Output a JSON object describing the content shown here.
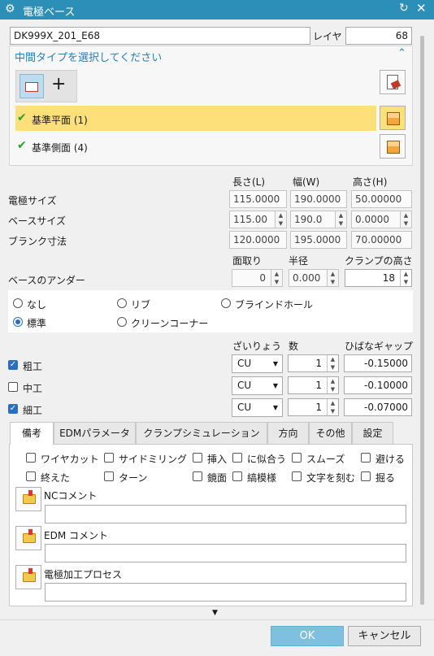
{
  "window": {
    "title": "電極ベース"
  },
  "name_field": {
    "value": "DK999X_201_E68"
  },
  "layer": {
    "label": "レイヤ",
    "value": "68"
  },
  "selection": {
    "prompt": "中間タイプを選択してください",
    "items": [
      {
        "label": "基準平面 (1)"
      },
      {
        "label": "基準側面 (4)"
      }
    ]
  },
  "dims": {
    "headers": {
      "length": "長さ(L)",
      "width": "幅(W)",
      "height": "高さ(H)"
    },
    "rows": [
      {
        "label": "電極サイズ",
        "v1": "115.0000",
        "v2": "190.0000",
        "v3": "50.00000"
      },
      {
        "label": "ベースサイズ",
        "v1": "115.00",
        "v2": "190.0",
        "v3": "0.0000"
      },
      {
        "label": "ブランク寸法",
        "v1": "120.0000",
        "v2": "195.0000",
        "v3": "70.00000"
      }
    ]
  },
  "under": {
    "label": "ベースのアンダー",
    "h_chamfer": "面取り",
    "h_radius": "半径",
    "h_clamp": "クランプの高さ",
    "chamfer": "0",
    "radius": "0.000",
    "clamp": "18"
  },
  "radios": {
    "none": "なし",
    "rib": "リブ",
    "blind": "ブラインドホール",
    "standard": "標準",
    "clean": "クリーンコーナー"
  },
  "machining": {
    "h_material": "ざいりょう",
    "h_count": "数",
    "h_gap": "ひばなギャップ",
    "rows": [
      {
        "label": "粗工",
        "checked": true,
        "material": "CU",
        "count": "1",
        "gap": "-0.15000"
      },
      {
        "label": "中工",
        "checked": false,
        "material": "CU",
        "count": "1",
        "gap": "-0.10000"
      },
      {
        "label": "細工",
        "checked": true,
        "material": "CU",
        "count": "1",
        "gap": "-0.07000"
      }
    ]
  },
  "tabs": [
    "備考",
    "EDMパラメータ",
    "クランプシミュレーション",
    "方向",
    "その他",
    "設定"
  ],
  "options": {
    "row1": [
      "ワイヤカット",
      "サイドミリング",
      "挿入",
      "に似合う",
      "スムーズ",
      "避ける"
    ],
    "row2": [
      "終えた",
      "ターン",
      "鏡面",
      "縞模様",
      "文字を刻む",
      "掘る"
    ]
  },
  "comments": {
    "nc": "NCコメント",
    "edm": "EDM コメント",
    "process": "電極加工プロセス"
  },
  "footer": {
    "ok": "OK",
    "cancel": "キャンセル"
  },
  "colors": {
    "title_bar": "#2c8fb8",
    "highlight": "#fde07a",
    "ok_button": "#7fbfdf"
  }
}
